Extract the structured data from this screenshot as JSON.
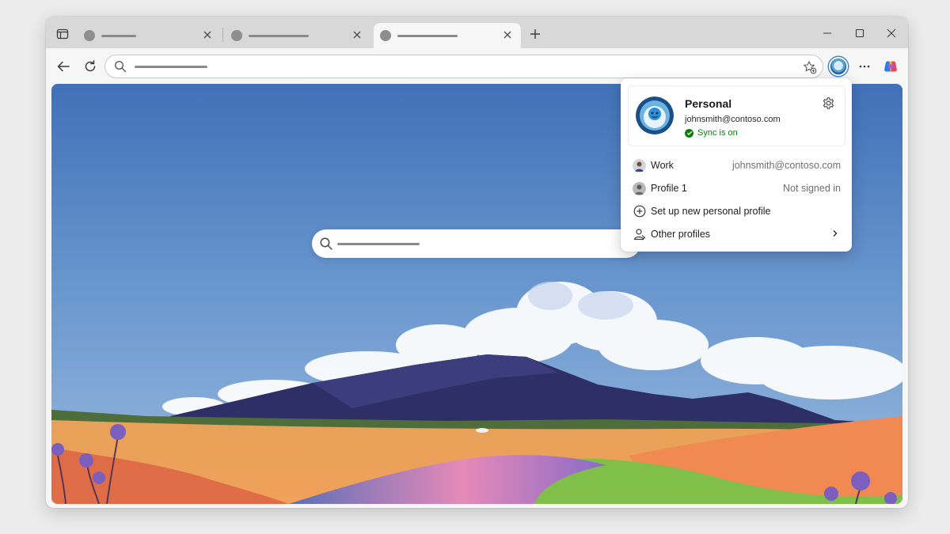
{
  "browser": {
    "tabs": [
      {
        "active": false
      },
      {
        "active": false
      },
      {
        "active": true
      }
    ],
    "toolbar": {
      "address_value": ""
    }
  },
  "profile_flyout": {
    "current": {
      "name": "Personal",
      "email": "johnsmith@contoso.com",
      "sync_status": "Sync is on"
    },
    "items": [
      {
        "label": "Work",
        "detail": "johnsmith@contoso.com"
      },
      {
        "label": "Profile 1",
        "detail": "Not signed in"
      },
      {
        "label": "Set up new personal profile",
        "detail": ""
      },
      {
        "label": "Other profiles",
        "detail": ""
      }
    ]
  },
  "colors": {
    "tabstrip": "#d8d8d8",
    "toolbar": "#f6f6f6",
    "sync_green": "#0f7b0f",
    "sky_top": "#4071b8",
    "sky_bottom": "#8fb4dc"
  },
  "icons": {
    "tab_actions": "tab-actions-icon",
    "new_tab": "plus-icon",
    "back": "back-arrow-icon",
    "refresh": "refresh-icon",
    "search": "search-icon",
    "favorite": "star-add-icon",
    "more": "more-icon",
    "copilot": "copilot-icon",
    "settings": "gear-icon",
    "add_profile": "plus-circle-icon",
    "other_profiles": "people-icon",
    "chevron": "chevron-right-icon"
  }
}
